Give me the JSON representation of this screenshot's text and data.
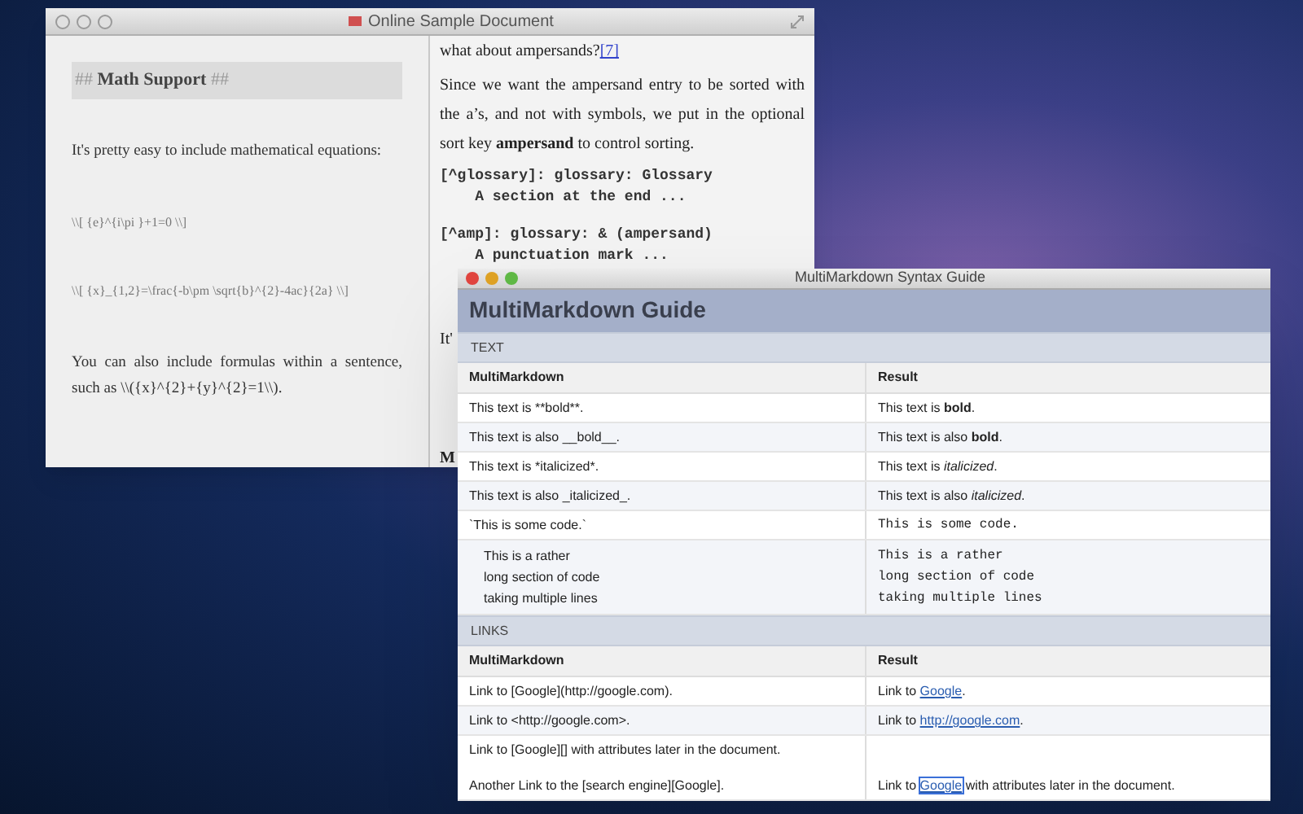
{
  "document_window": {
    "title": "Online Sample Document",
    "left_pane": {
      "heading": "## **Math Support** ##",
      "blocks": [
        {
          "kind": "text",
          "text": "It's pretty easy to include mathematical equations:"
        },
        {
          "kind": "math",
          "text": "\\\\[ {e}^{i\\pi }+1=0 \\\\]"
        },
        {
          "kind": "math",
          "text": "\\\\[ {x}_{1,2}=\\frac{-b\\pm \\sqrt{b}^{2}-4ac}{2a} \\\\]"
        },
        {
          "kind": "text",
          "text": "You can also include formulas within a sentence, such as \\\\({x}^{2}+{y}^{2}=1\\\\)."
        }
      ]
    },
    "right_pane": {
      "blocks": [
        {
          "kind": "link_line",
          "text": "what about ampersands?",
          "link": "[7]"
        },
        {
          "kind": "text",
          "text": "Since we want the ampersand entry to be sorted with the a’s, and not with symbols, we put in the optional sort key **ampersand** to control sorting."
        },
        {
          "kind": "code",
          "text": "[^glossary]: glossary: Glossary\n    A section at the end ..."
        },
        {
          "kind": "code",
          "text": "[^amp]: glossary: & (ampersand)\n    A punctuation mark ..."
        },
        {
          "kind": "text",
          "text": "It'"
        },
        {
          "kind": "heading",
          "text": "M"
        }
      ]
    }
  },
  "guide_window": {
    "title": "MultiMarkdown Syntax Guide",
    "heading": "MultiMarkdown Guide",
    "sections": [
      {
        "label": "TEXT",
        "columns": [
          "MultiMarkdown",
          "Result"
        ],
        "rows": [
          {
            "kind": "plain",
            "source": "This text is **bold**.",
            "result": "This text is **bold**."
          },
          {
            "kind": "plain",
            "source": "This text is also __bold__.",
            "result": "This text is also **bold**."
          },
          {
            "kind": "plain",
            "source": "This text is *italicized*.",
            "result": "This text is *italicized*."
          },
          {
            "kind": "plain",
            "source": "This text is also _italicized_.",
            "result": "This text is also *italicized*."
          },
          {
            "kind": "code",
            "source": "`This is some code.`",
            "result": "This is some code."
          },
          {
            "kind": "codeblock",
            "source": "This is a rather\nlong section of code\ntaking multiple lines",
            "result": "This is a rather\nlong section of code\ntaking multiple lines"
          }
        ]
      },
      {
        "label": "LINKS",
        "columns": [
          "MultiMarkdown",
          "Result"
        ],
        "rows": [
          {
            "kind": "link",
            "source": "Link to [Google](http://google.com).",
            "result": [
              {
                "text": "Link to "
              },
              {
                "link": "Google",
                "focused": false
              },
              {
                "text": "."
              }
            ]
          },
          {
            "kind": "link",
            "source": "Link to <http://google.com>.",
            "result": [
              {
                "text": "Link to "
              },
              {
                "link": "http://google.com",
                "focused": false
              },
              {
                "text": "."
              }
            ]
          },
          {
            "kind": "link",
            "source": "Link to [Google][] with attributes later in the document.\n\nAnother Link to the [search engine][Google].",
            "result": [
              {
                "text": "Link to "
              },
              {
                "link": "Google",
                "focused": true
              },
              {
                "text": " with attributes later in the document."
              }
            ]
          }
        ]
      }
    ]
  }
}
